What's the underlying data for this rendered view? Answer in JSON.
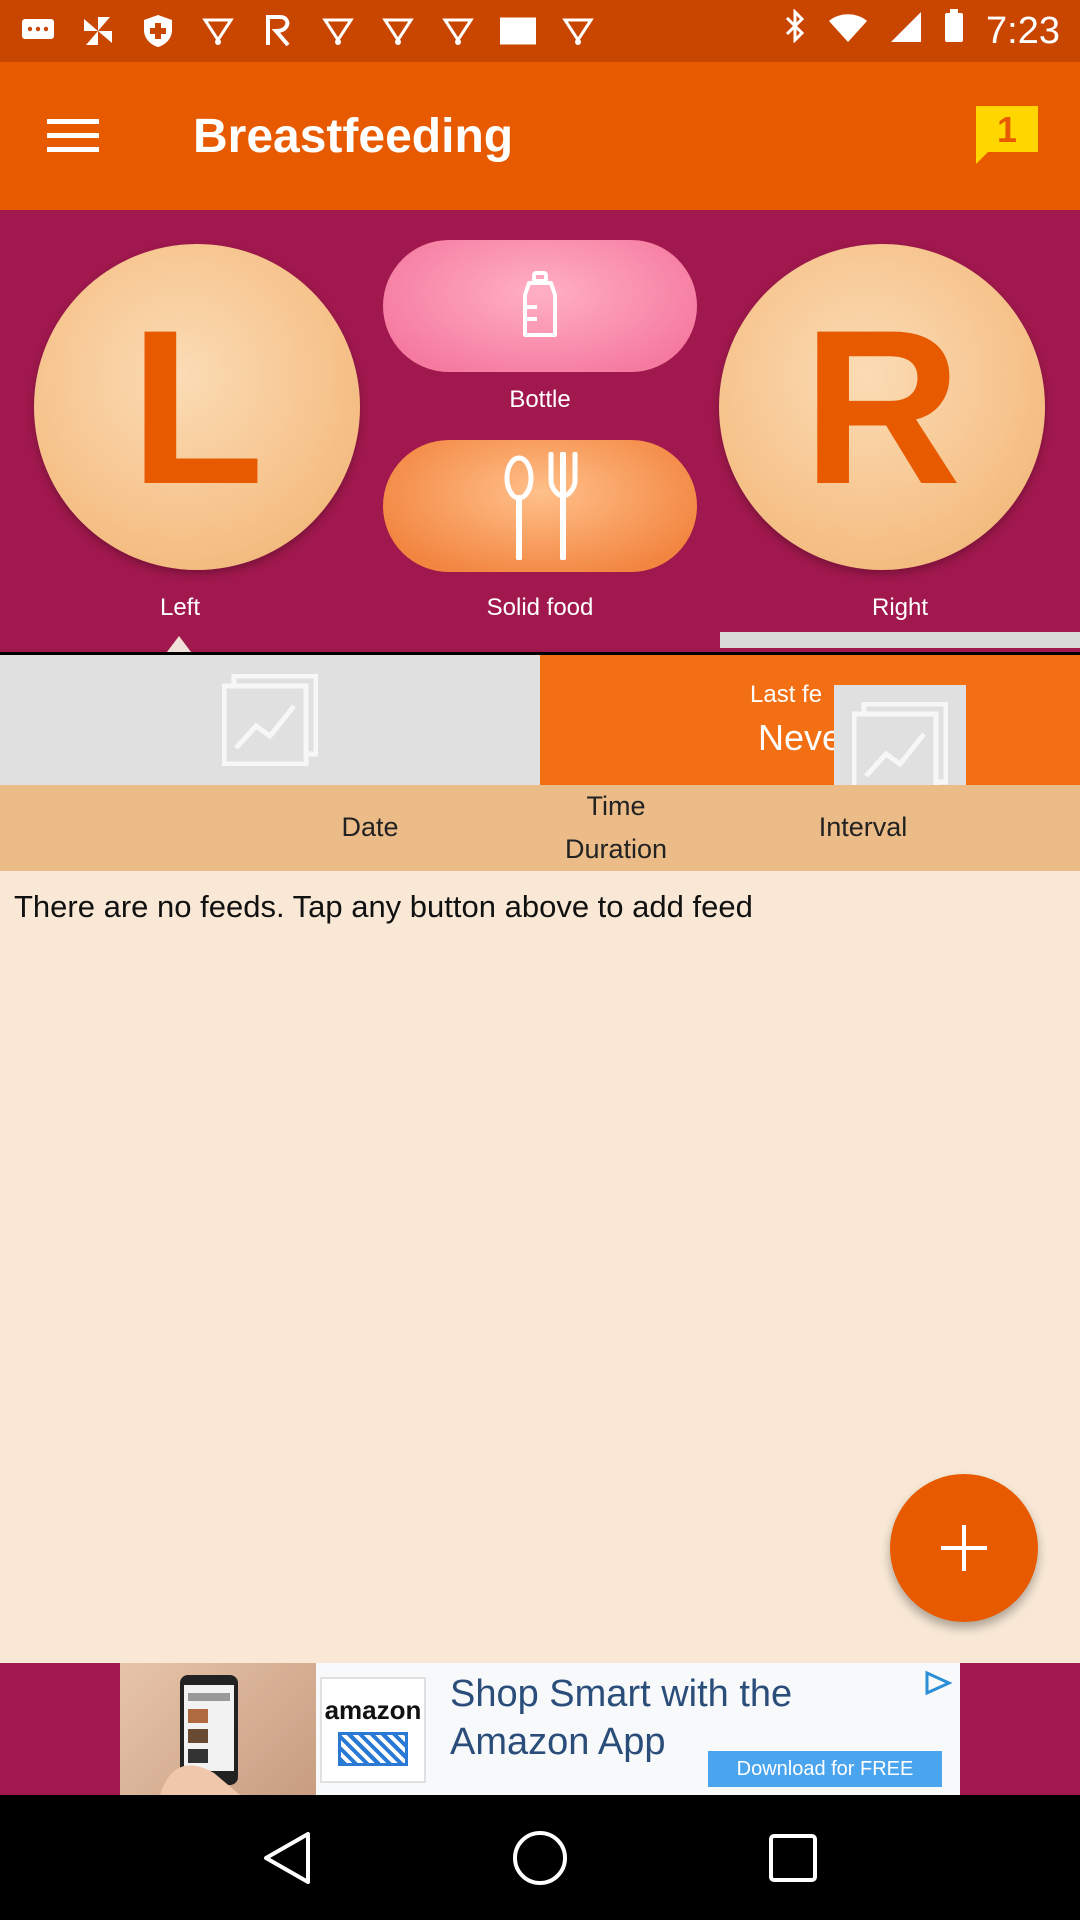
{
  "status_bar": {
    "time": "7:23",
    "left_icons": [
      "message-icon",
      "pinwheel-icon",
      "shield-icon",
      "bulb-icon",
      "r-icon",
      "bulb-icon",
      "bulb-icon",
      "bulb-icon",
      "square-icon",
      "bulb-icon"
    ],
    "right_icons": [
      "bluetooth-icon",
      "wifi-icon",
      "signal-icon",
      "battery-icon"
    ]
  },
  "app_bar": {
    "title": "Breastfeeding",
    "badge_count": "1"
  },
  "feed_buttons": {
    "left_letter": "L",
    "left_label": "Left",
    "right_letter": "R",
    "right_label": "Right",
    "bottle_label": "Bottle",
    "solid_label": "Solid food"
  },
  "last_feed": {
    "label": "Last fe",
    "value": "Neve"
  },
  "table_header": {
    "date": "Date",
    "time": "Time",
    "duration": "Duration",
    "interval": "Interval"
  },
  "empty_message": "There are no feeds. Tap any button above to add feed",
  "ad": {
    "brand": "amazon",
    "line1": "Shop Smart with the",
    "line2": "Amazon App",
    "cta": "Download for FREE"
  },
  "colors": {
    "app_bar": "#e85a00",
    "hero_bg": "#a0184d",
    "accent_orange": "#f36f14",
    "header_bg": "#ecbc88",
    "content_bg": "#f8e8d5"
  }
}
